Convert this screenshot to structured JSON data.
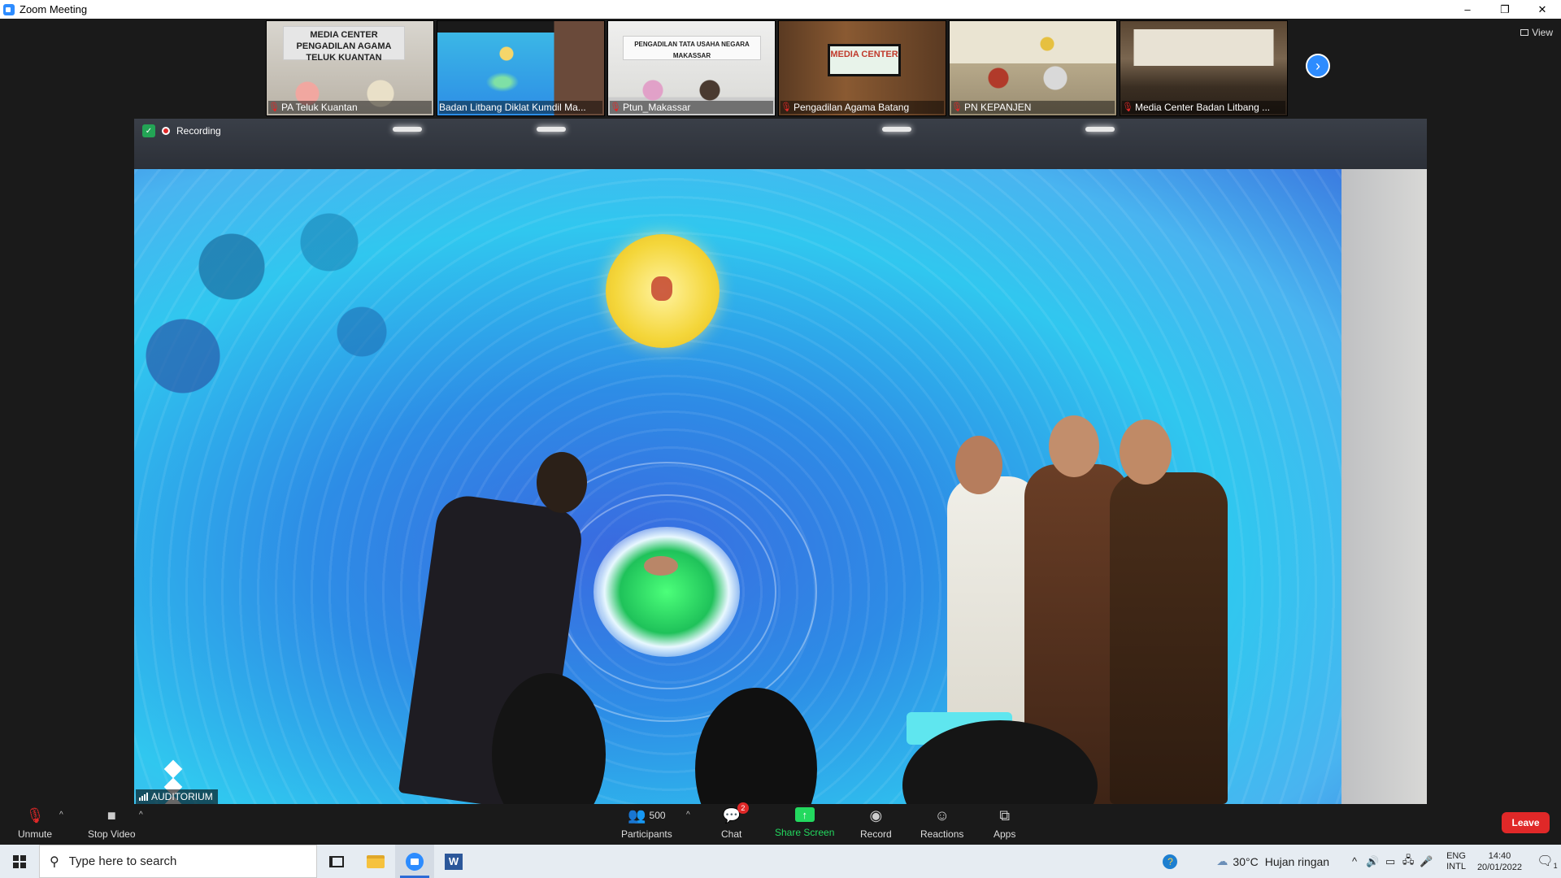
{
  "window": {
    "title": "Zoom Meeting",
    "controls": {
      "minimize": "–",
      "maximize": "❐",
      "close": "✕"
    }
  },
  "gallery": {
    "participants": [
      {
        "name": "PA Teluk Kuantan",
        "sign": "MEDIA CENTER\nPENGADILAN AGAMA TELUK KUANTAN",
        "muted": true
      },
      {
        "name": "Badan Litbang Diklat Kumdil Ma...",
        "sign": "",
        "muted": false
      },
      {
        "name": "Ptun_Makassar",
        "sign": "PENGADILAN TATA USAHA NEGARA\nMAKASSAR",
        "muted": true
      },
      {
        "name": "Pengadilan Agama Batang",
        "sign": "MEDIA CENTER",
        "muted": true
      },
      {
        "name": "PN KEPANJEN",
        "sign": "",
        "muted": true
      },
      {
        "name": "Media Center Badan Litbang ...",
        "sign": "",
        "muted": true
      }
    ],
    "next_icon": "chevron-right-icon",
    "view_label": "View"
  },
  "main_video": {
    "recording_label": "Recording",
    "speaker_name": "AUDITORIUM"
  },
  "toolbar": {
    "unmute_label": "Unmute",
    "stop_video_label": "Stop Video",
    "participants_label": "Participants",
    "participants_count": "500",
    "chat_label": "Chat",
    "chat_badge": "2",
    "share_label": "Share Screen",
    "record_label": "Record",
    "reactions_label": "Reactions",
    "apps_label": "Apps",
    "leave_label": "Leave"
  },
  "taskbar": {
    "search_placeholder": "Type here to search",
    "word_letter": "W",
    "weather_temp": "30°C",
    "weather_desc": "Hujan ringan",
    "lang_top": "ENG",
    "lang_bottom": "INTL",
    "time": "14:40",
    "date": "20/01/2022",
    "notification_count": "1"
  },
  "colors": {
    "zoom_blue": "#2d8cff",
    "leave_red": "#e02828",
    "share_green": "#23d95f"
  }
}
